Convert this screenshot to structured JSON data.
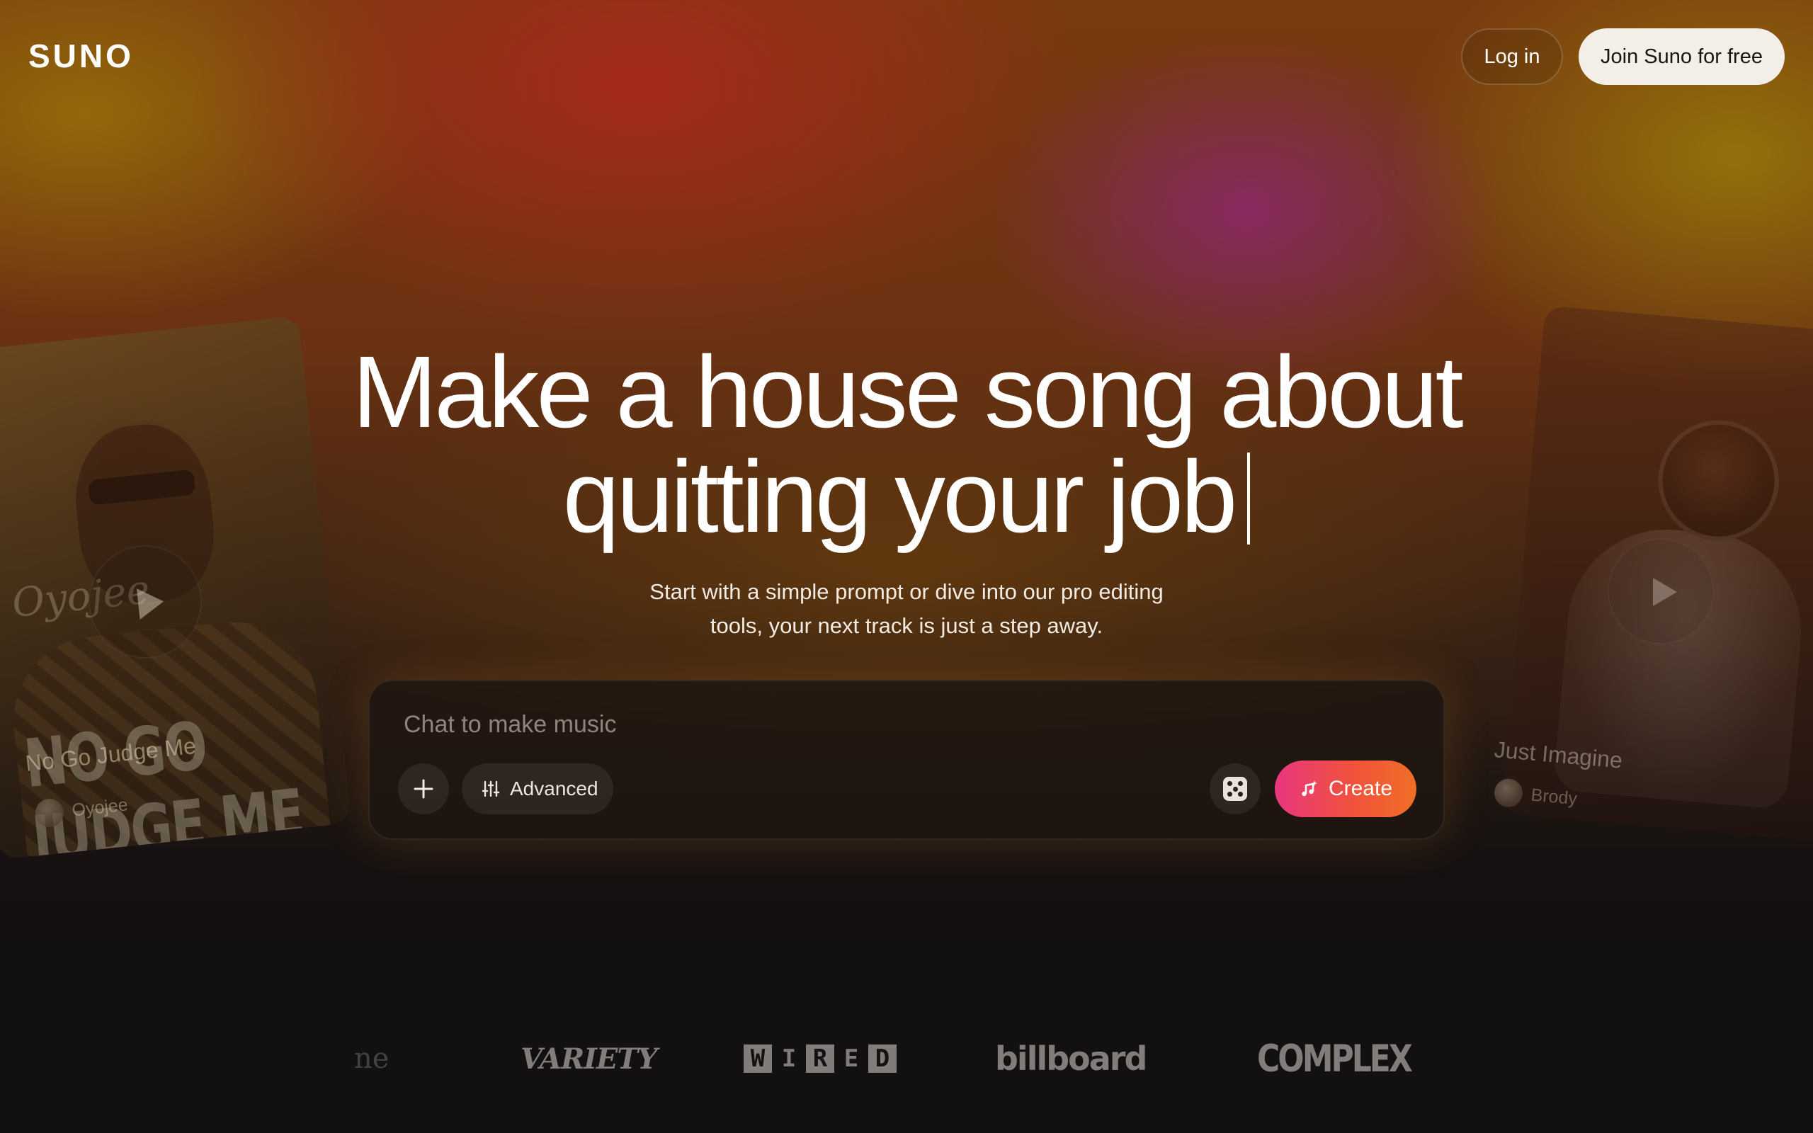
{
  "header": {
    "logo": "SUNO",
    "login_label": "Log in",
    "join_label": "Join Suno for free"
  },
  "hero": {
    "line1": "Make a house song about",
    "line2": "quitting your job",
    "subtitle_line1": "Start with a simple prompt or dive into our pro editing",
    "subtitle_line2": "tools, your next track is just a step away."
  },
  "composer": {
    "placeholder": "Chat to make music",
    "value": "",
    "advanced_label": "Advanced",
    "create_label": "Create"
  },
  "cards": {
    "left": {
      "art_watermark": "Oyojee",
      "art_title": "NO GO JUDGE ME",
      "title": "No Go Judge Me",
      "artist": "Oyojee"
    },
    "right": {
      "title": "Just Imagine",
      "artist": "Brody"
    }
  },
  "press": {
    "partial": "ne",
    "variety": "VARIETY",
    "wired": [
      "W",
      "I",
      "R",
      "E",
      "D"
    ],
    "billboard": "billboard",
    "complex": "COMPLEX"
  },
  "colors": {
    "create_gradient_start": "#e8367e",
    "create_gradient_end": "#ef6f25",
    "join_bg": "#f3efe8"
  },
  "icons": {
    "plus": "plus-icon",
    "advanced": "sliders-icon",
    "dice": "dice-icon",
    "create": "music-sparkle-icon",
    "play": "play-icon"
  }
}
